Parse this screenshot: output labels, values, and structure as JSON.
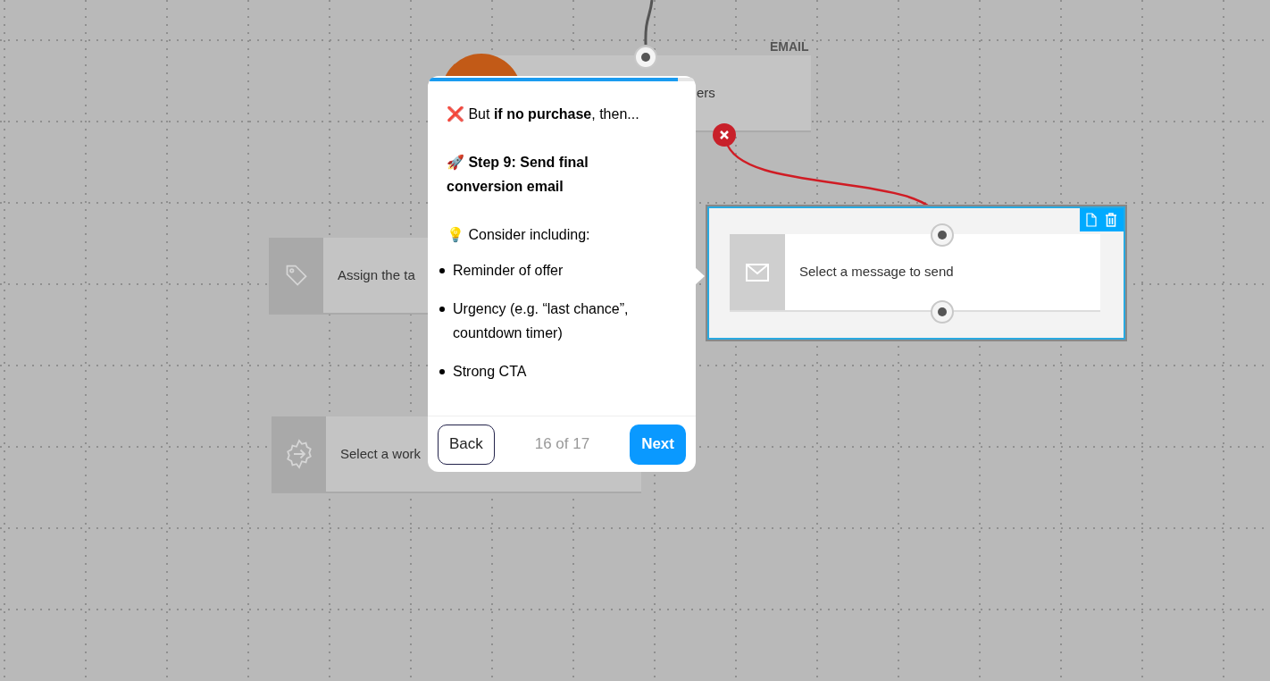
{
  "canvas": {
    "nodes": [
      {
        "kind": "email",
        "label": "EMAIL",
        "text": "ers",
        "selected": false
      },
      {
        "kind": "tag",
        "text": "Assign the ta",
        "selected": false
      },
      {
        "kind": "workflow",
        "text": "Select a work",
        "selected": false
      },
      {
        "kind": "message",
        "text": "Select a message to send",
        "selected": true
      }
    ]
  },
  "tour": {
    "level": 0.94,
    "blocks": [
      {
        "kind": "paragraph",
        "text": "❌ But **if no purchase**, then..."
      },
      {
        "kind": "heading",
        "text": "🚀 Step 9: Send final conversion email"
      },
      {
        "kind": "paragraph",
        "text": "💡 Consider including:"
      },
      {
        "kind": "list",
        "items": [
          "Reminder of offer",
          "Urgency (e.g. “last chance”, countdown timer)",
          "Strong CTA"
        ]
      }
    ],
    "back": "Back",
    "counter": "16 of 17",
    "next": "Next"
  }
}
